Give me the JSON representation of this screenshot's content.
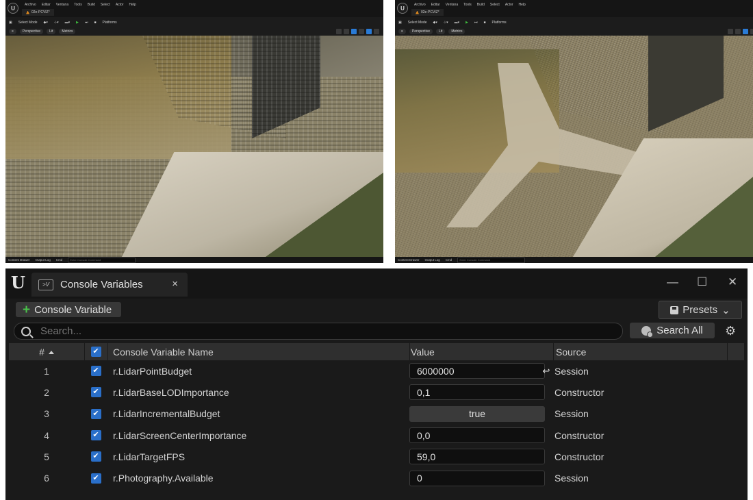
{
  "editor_left": {
    "menu": [
      "Archivo",
      "Editar",
      "Ventana",
      "Tools",
      "Build",
      "Select",
      "Actor",
      "Help"
    ],
    "level_tab": "02e-PCVIZ*",
    "toolbar": {
      "select_mode": "Select Mode",
      "platforms": "Platforms"
    },
    "viewport": {
      "perspective": "Perspective",
      "lit": "Lit",
      "metrics": "Metrics"
    },
    "status": {
      "content_drawer": "Content Drawer",
      "output_log": "Output Log",
      "cmd": "Cmd",
      "cmd_placeholder": "Enter Console Command"
    }
  },
  "editor_right": {
    "menu": [
      "Archivo",
      "Editar",
      "Ventana",
      "Tools",
      "Build",
      "Select",
      "Actor",
      "Help"
    ],
    "level_tab": "02e-PCVIZ*",
    "toolbar": {
      "select_mode": "Select Mode",
      "platforms": "Platforms"
    },
    "viewport": {
      "perspective": "Perspective",
      "lit": "Lit",
      "metrics": "Metrics"
    },
    "status": {
      "content_drawer": "Content Drawer",
      "output_log": "Output Log",
      "cmd": "Cmd",
      "cmd_placeholder": "Enter Console Command"
    }
  },
  "console_vars": {
    "tab_title": "Console Variables",
    "tab_close": "×",
    "window_controls": {
      "minimize": "—",
      "maximize": "☐",
      "close": "✕"
    },
    "add_button": "Console Variable",
    "presets_button": "Presets",
    "search_placeholder": "Search...",
    "search_all_button": "Search All",
    "columns": {
      "num": "#",
      "name": "Console Variable Name",
      "value": "Value",
      "source": "Source"
    },
    "rows": [
      {
        "num": "1",
        "name": "r.LidarPointBudget",
        "value": "6000000",
        "type": "text",
        "source": "Session",
        "reset": true
      },
      {
        "num": "2",
        "name": "r.LidarBaseLODImportance",
        "value": "0,1",
        "type": "text",
        "source": "Constructor",
        "reset": false
      },
      {
        "num": "3",
        "name": "r.LidarIncrementalBudget",
        "value": "true",
        "type": "bool",
        "source": "Session",
        "reset": false
      },
      {
        "num": "4",
        "name": "r.LidarScreenCenterImportance",
        "value": "0,0",
        "type": "text",
        "source": "Constructor",
        "reset": false
      },
      {
        "num": "5",
        "name": "r.LidarTargetFPS",
        "value": "59,0",
        "type": "text",
        "source": "Constructor",
        "reset": false
      },
      {
        "num": "6",
        "name": "r.Photography.Available",
        "value": "0",
        "type": "text",
        "source": "Session",
        "reset": false
      }
    ]
  },
  "icons": {
    "ue_logo": "unreal-logo-icon",
    "tab_icon": "console-variables-icon",
    "add": "plus-icon",
    "presets": "save-icon",
    "search": "search-icon",
    "search_all": "globe-search-icon",
    "settings": "gear-icon",
    "reset": "reset-arrow-icon",
    "checkbox": "checkbox-checked-icon"
  },
  "colors": {
    "accent_blue": "#2a6fc9",
    "add_green": "#49c24a",
    "panel_bg": "#1a1a1a",
    "header_bg": "#2f2f2f"
  }
}
